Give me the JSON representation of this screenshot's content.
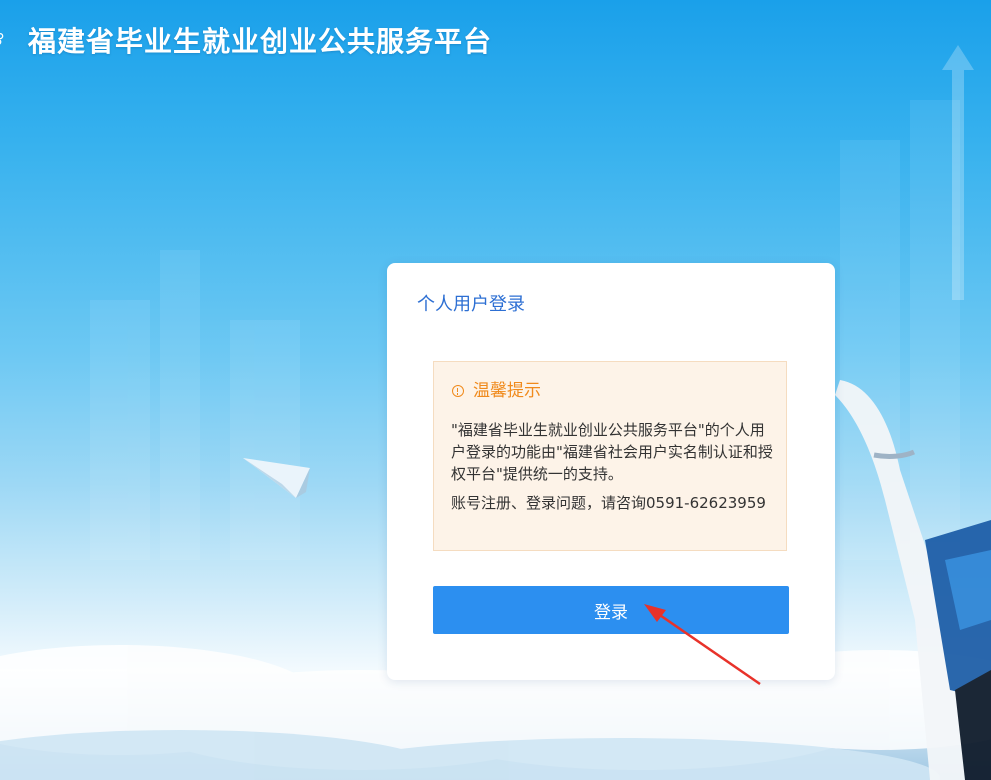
{
  "header": {
    "title": "福建省毕业生就业创业公共服务平台",
    "logo_icon": "emblem-icon"
  },
  "login_card": {
    "title": "个人用户登录",
    "notice": {
      "icon": "info-circle-icon",
      "heading": "温馨提示",
      "body": "\"福建省毕业生就业创业公共服务平台\"的个人用户登录的功能由\"福建省社会用户实名制认证和授权平台\"提供统一的支持。",
      "contact": "账号注册、登录问题，请咨询0591-62623959"
    },
    "login_button": "登录"
  },
  "colors": {
    "accent": "#2c8ff0",
    "title_blue": "#2d6fd3",
    "notice_orange": "#f08a1c",
    "notice_bg": "#fdf3e8",
    "annotation_arrow": "#e8322a"
  }
}
